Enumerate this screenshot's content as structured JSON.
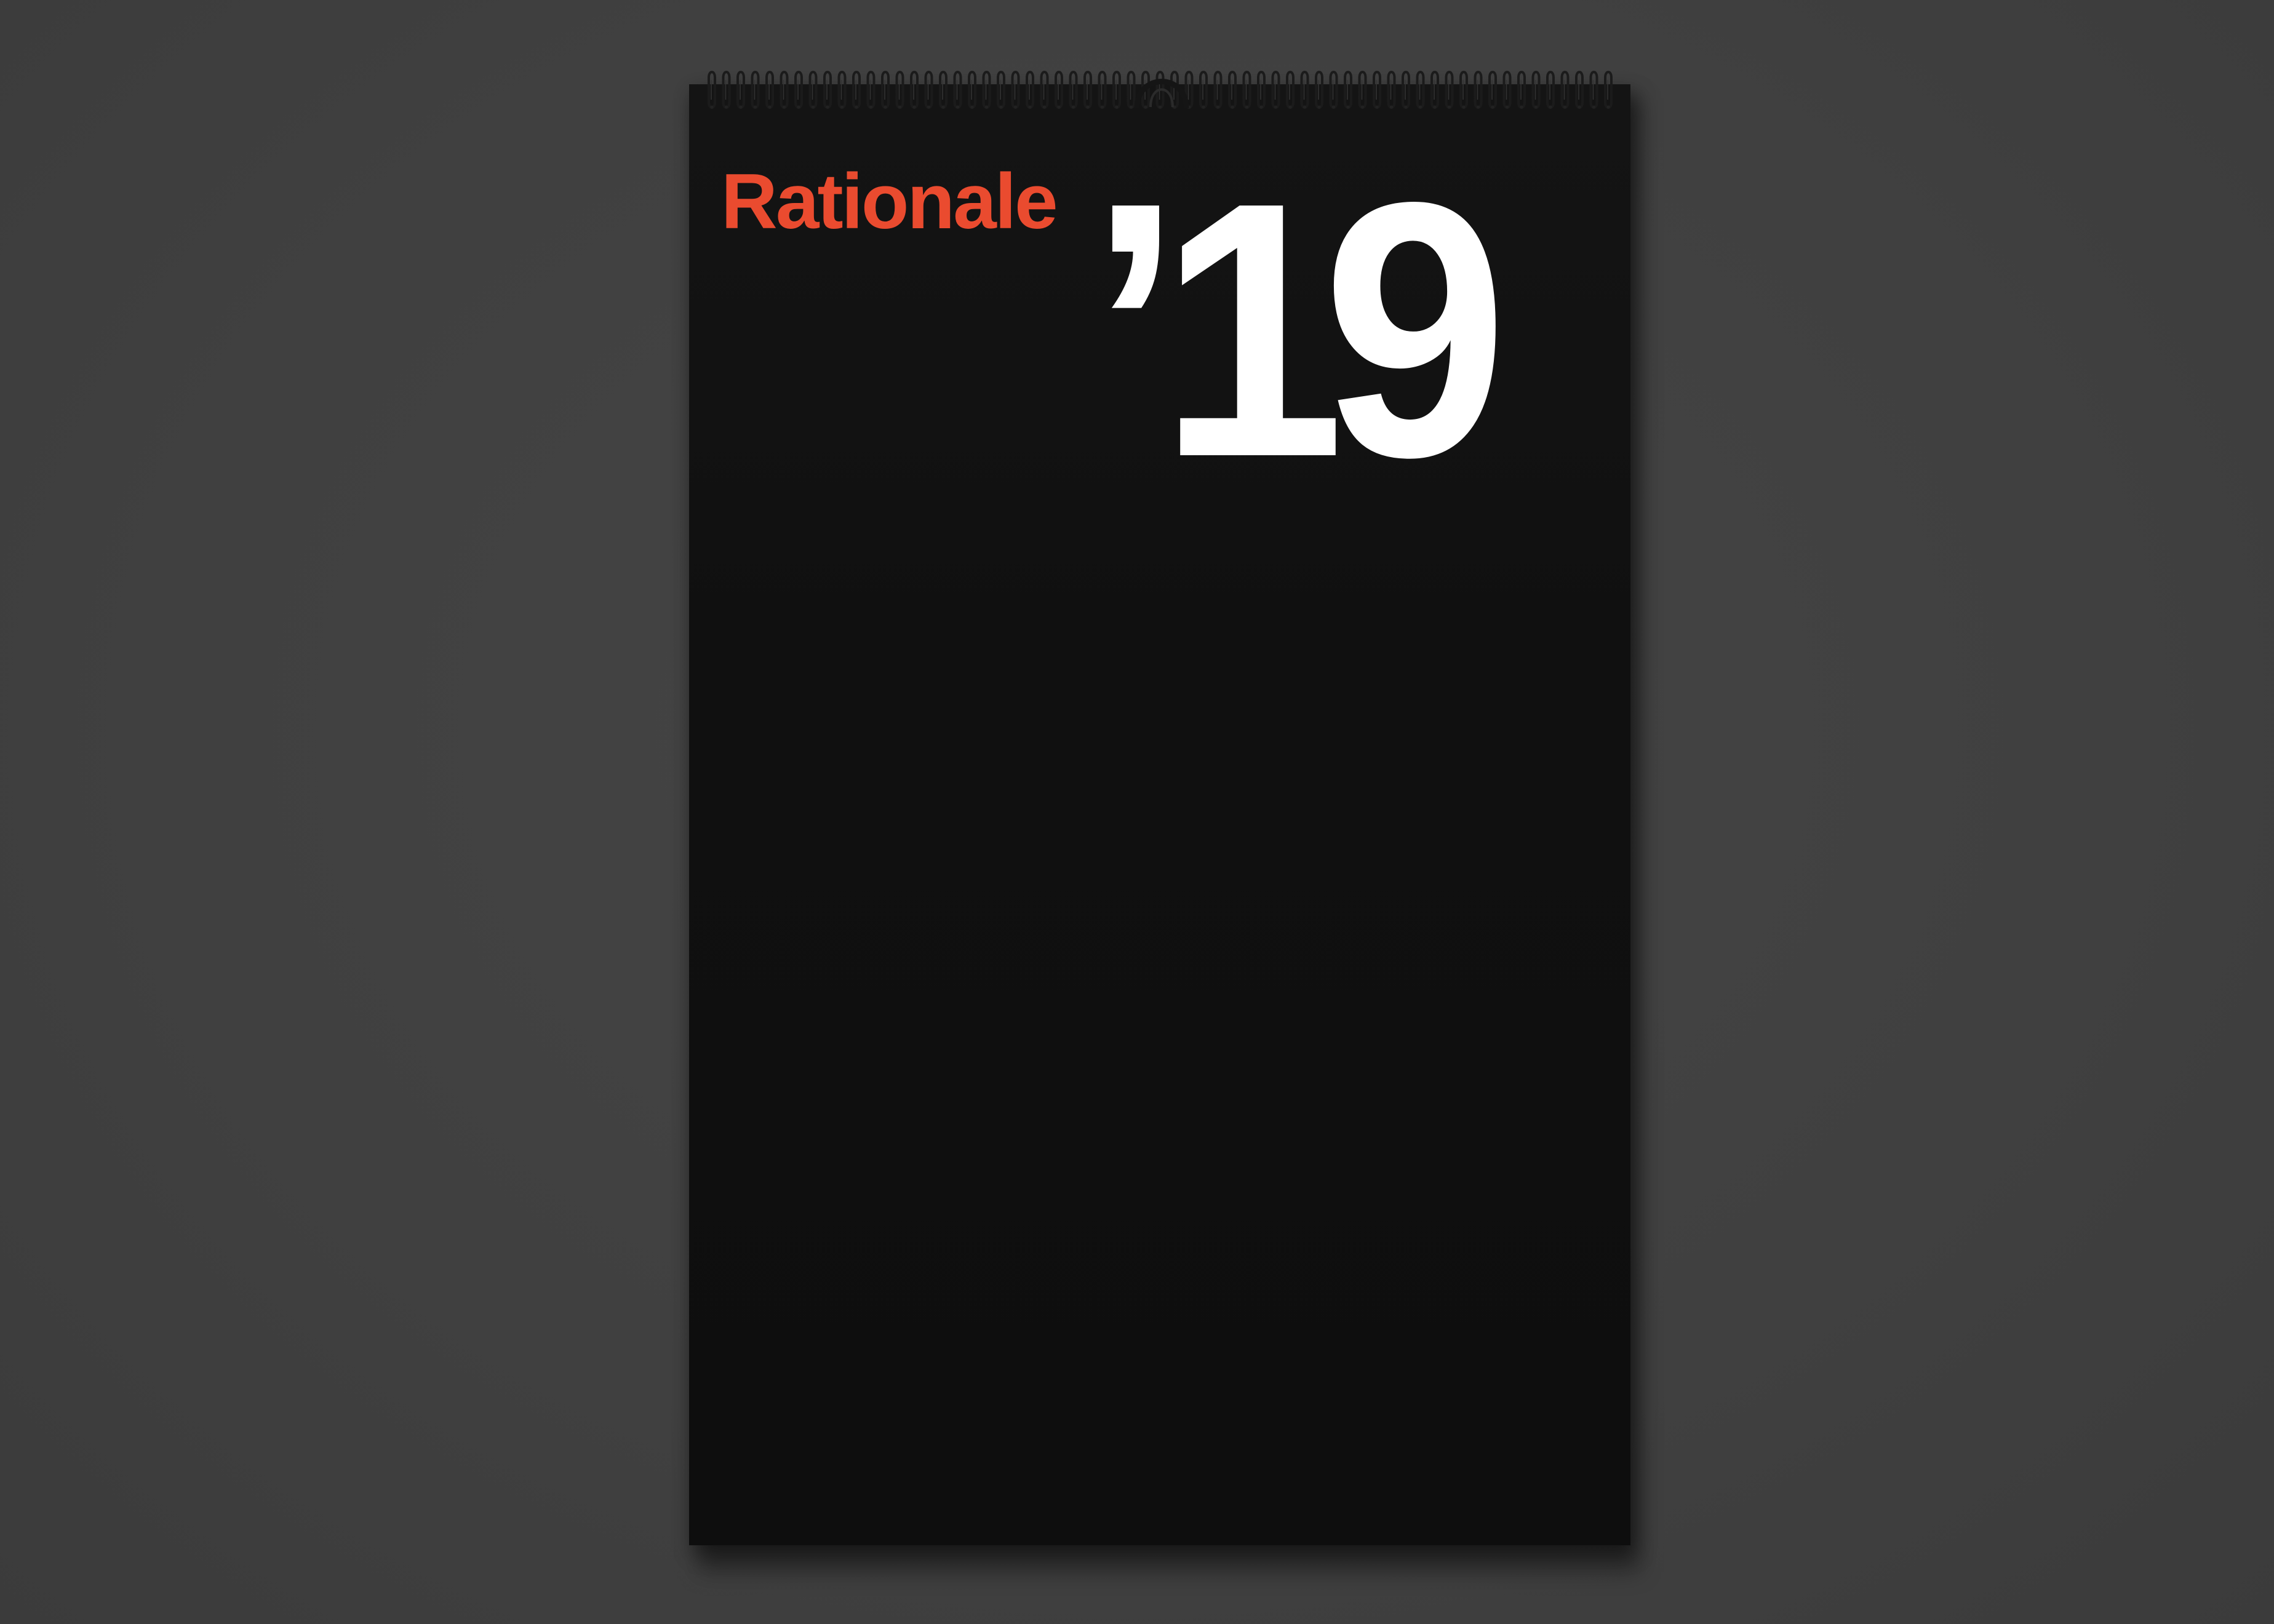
{
  "calendar": {
    "brand_name": "Rationale",
    "year_label": "’19"
  },
  "colors": {
    "background": "#3f3f3f",
    "calendar_paper": "#111111",
    "brand_accent": "#ea4b2f",
    "year_text": "#ffffff",
    "spiral_binding": "#1a1a1a"
  },
  "icons": {
    "binding": "spiral-binding-icon",
    "hanger": "hanging-ring-icon"
  }
}
